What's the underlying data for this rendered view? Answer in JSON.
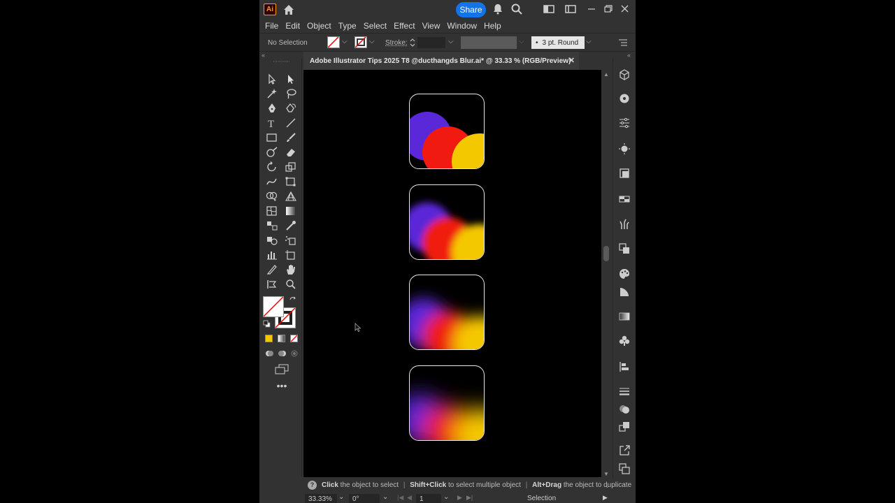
{
  "app": {
    "logo": "Ai",
    "share_label": "Share"
  },
  "menu": [
    "File",
    "Edit",
    "Object",
    "Type",
    "Select",
    "Effect",
    "View",
    "Window",
    "Help"
  ],
  "control": {
    "selection_label": "No Selection",
    "stroke_label": "Stroke:",
    "brush_label": "3 pt. Round"
  },
  "document": {
    "tab_title": "Adobe Illustrator Tips 2025 T8 @ducthangds Blur.ai* @ 33.33 % (RGB/Preview)"
  },
  "status": {
    "hint_click": "Click",
    "hint_click_text": " the object to select",
    "hint_shift": "Shift+Click",
    "hint_shift_text": " to select multiple object",
    "hint_alt": "Alt+Drag",
    "hint_alt_text": " the object to duplicate",
    "zoom": "33.33%",
    "rotation": "0°",
    "artboard": "1",
    "tool": "Selection"
  },
  "colors": {
    "purple": "#5a28d8",
    "red": "#f01a10",
    "yellow": "#f4c800",
    "accent": "#1473e6"
  }
}
